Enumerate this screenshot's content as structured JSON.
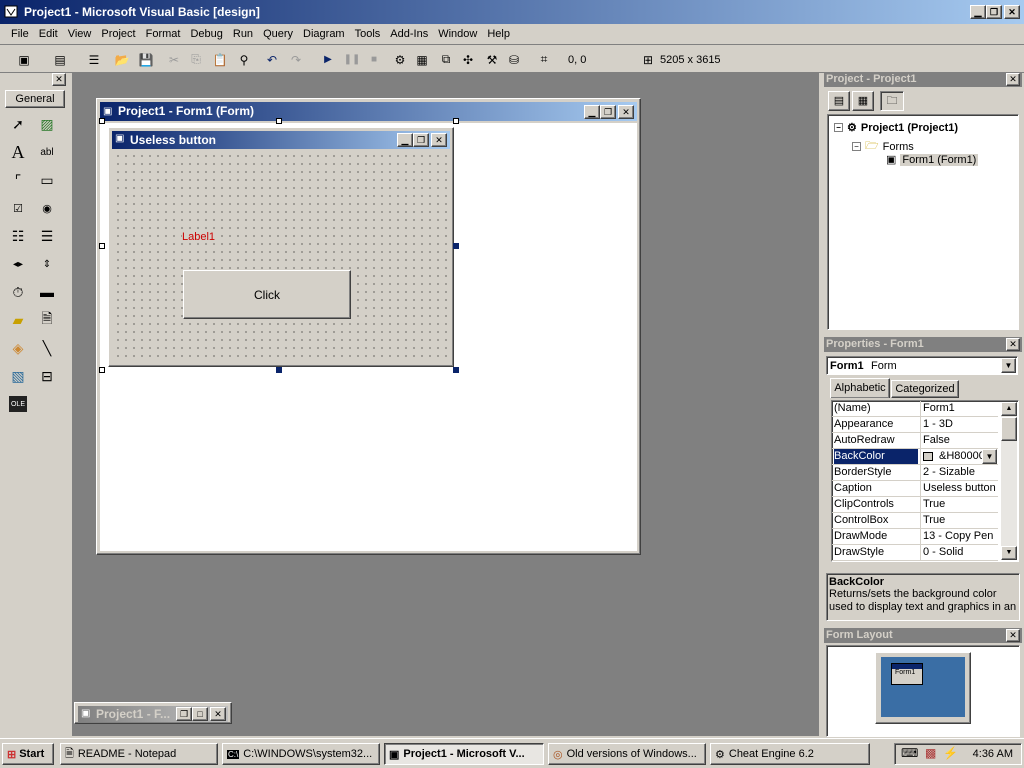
{
  "window": {
    "title": "Project1 - Microsoft Visual Basic [design]"
  },
  "menu": [
    "File",
    "Edit",
    "View",
    "Project",
    "Format",
    "Debug",
    "Run",
    "Query",
    "Diagram",
    "Tools",
    "Add-Ins",
    "Window",
    "Help"
  ],
  "toolbar": {
    "position": "0, 0",
    "size": "5205 x 3615"
  },
  "toolbox": {
    "tab_label": "General",
    "tools": [
      "pointer",
      "picturebox",
      "label",
      "textbox",
      "frame",
      "commandbutton",
      "checkbox",
      "optionbutton",
      "combobox",
      "listbox",
      "hscrollbar",
      "vscrollbar",
      "timer",
      "drivelistbox",
      "dirlistbox",
      "filelistbox",
      "shape",
      "line",
      "image",
      "data",
      "ole"
    ]
  },
  "form_designer": {
    "title": "Project1 - Form1 (Form)",
    "form_caption": "Useless button",
    "label": "Label1",
    "button": "Click"
  },
  "minimized_window": {
    "title": "Project1 - F..."
  },
  "project_explorer": {
    "title": "Project - Project1",
    "root": "Project1 (Project1)",
    "folder": "Forms",
    "item": "Form1 (Form1)"
  },
  "properties": {
    "title": "Properties - Form1",
    "object": "Form1",
    "object_type": "Form",
    "tabs": [
      "Alphabetic",
      "Categorized"
    ],
    "rows": [
      {
        "name": "(Name)",
        "value": "Form1"
      },
      {
        "name": "Appearance",
        "value": "1 - 3D"
      },
      {
        "name": "AutoRedraw",
        "value": "False"
      },
      {
        "name": "BackColor",
        "value": "&H80000"
      },
      {
        "name": "BorderStyle",
        "value": "2 - Sizable"
      },
      {
        "name": "Caption",
        "value": "Useless button"
      },
      {
        "name": "ClipControls",
        "value": "True"
      },
      {
        "name": "ControlBox",
        "value": "True"
      },
      {
        "name": "DrawMode",
        "value": "13 - Copy Pen"
      },
      {
        "name": "DrawStyle",
        "value": "0 - Solid"
      }
    ],
    "desc_title": "BackColor",
    "desc_text": "Returns/sets the background color used to display text and graphics in an"
  },
  "form_layout": {
    "title": "Form Layout",
    "preview_text": "Form1"
  },
  "taskbar": {
    "start": "Start",
    "tasks": [
      "README - Notepad",
      "C:\\WINDOWS\\system32...",
      "Project1 - Microsoft V...",
      "Old versions of Windows...",
      "Cheat Engine 6.2"
    ],
    "clock": "4:36 AM"
  },
  "colors": {
    "accent": "#0a246a",
    "label_red": "#cc0000",
    "desktop_blue": "#3a6ea5"
  }
}
